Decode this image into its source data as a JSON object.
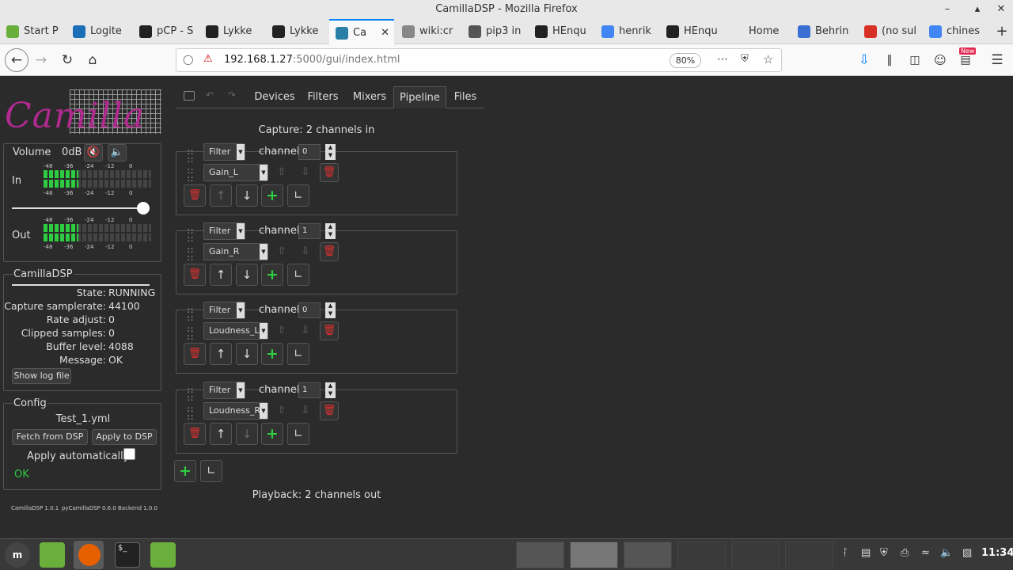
{
  "window": {
    "title": "CamillaDSP - Mozilla Firefox"
  },
  "tabs": [
    {
      "label": "Start P",
      "icon": "mint-icon",
      "color": "#6aaf3b"
    },
    {
      "label": "Logite",
      "icon": "logitech-icon",
      "color": "#1b6fb8"
    },
    {
      "label": "pCP - S",
      "icon": "pcp-icon",
      "color": "#222222"
    },
    {
      "label": "Lykke",
      "icon": "github-icon",
      "color": "#222222"
    },
    {
      "label": "Lykke",
      "icon": "github-icon",
      "color": "#222222"
    },
    {
      "label": "Ca",
      "icon": "camilla-icon",
      "color": "#2a7fa8"
    },
    {
      "label": "wiki:cr",
      "icon": "wiki-icon",
      "color": "#888888"
    },
    {
      "label": "pip3 in",
      "icon": "pip-icon",
      "color": "#555555"
    },
    {
      "label": "HEnqu",
      "icon": "github-icon",
      "color": "#222222"
    },
    {
      "label": "henrik",
      "icon": "google-icon",
      "color": "#4285f4"
    },
    {
      "label": "HEnqu",
      "icon": "github-icon",
      "color": "#222222"
    },
    {
      "label": "Home",
      "icon": "none",
      "color": "#e8e8e8"
    },
    {
      "label": "Behrin",
      "icon": "behringer-icon",
      "color": "#3b6fd4"
    },
    {
      "label": "(no sul",
      "icon": "gmail-icon",
      "color": "#d93025"
    },
    {
      "label": "chines",
      "icon": "google-icon",
      "color": "#4285f4"
    }
  ],
  "url": {
    "host": "192.168.1.27",
    "rest": ":5000/gui/index.html"
  },
  "zoom": "80%",
  "new_badge": "New",
  "logo": "CamillaDSP",
  "volume": {
    "label": "Volume",
    "value": "0dB",
    "in_label": "In",
    "out_label": "Out",
    "scale": [
      "-48",
      "-36",
      "-24",
      "-12",
      "0"
    ],
    "slider_position": 1.0,
    "in_levels": [
      0.27,
      0.27
    ],
    "out_levels": [
      0.27,
      0.27
    ]
  },
  "status": {
    "title": "CamillaDSP",
    "rows": [
      {
        "k": "State:",
        "v": "RUNNING"
      },
      {
        "k": "Capture samplerate:",
        "v": "44100"
      },
      {
        "k": "Rate adjust:",
        "v": "0"
      },
      {
        "k": "Clipped samples:",
        "v": "0"
      },
      {
        "k": "Buffer level:",
        "v": "4088"
      },
      {
        "k": "Message:",
        "v": "OK"
      }
    ],
    "log_button": "Show log file"
  },
  "config": {
    "title": "Config",
    "filename": "Test_1.yml",
    "fetch_button": "Fetch from DSP",
    "apply_button": "Apply to DSP",
    "auto_label": "Apply automatically",
    "message": "OK"
  },
  "footer": {
    "a": "CamillaDSP 1.0.1",
    "b": "pyCamillaDSP 0.6.0",
    "c": "Backend 1.0.0"
  },
  "nav": [
    "Devices",
    "Filters",
    "Mixers",
    "Pipeline",
    "Files"
  ],
  "pipeline": {
    "capture": "Capture: 2 channels in",
    "playback": "Playback: 2 channels out",
    "steps": [
      {
        "type": "Filter",
        "channel_label": "channel",
        "channel": "0",
        "filter": "Gain_L"
      },
      {
        "type": "Filter",
        "channel_label": "channel",
        "channel": "1",
        "filter": "Gain_R"
      },
      {
        "type": "Filter",
        "channel_label": "channel",
        "channel": "0",
        "filter": "Loudness_L"
      },
      {
        "type": "Filter",
        "channel_label": "channel",
        "channel": "1",
        "filter": "Loudness_R"
      }
    ]
  },
  "taskbar": {
    "clock": "11:34"
  }
}
